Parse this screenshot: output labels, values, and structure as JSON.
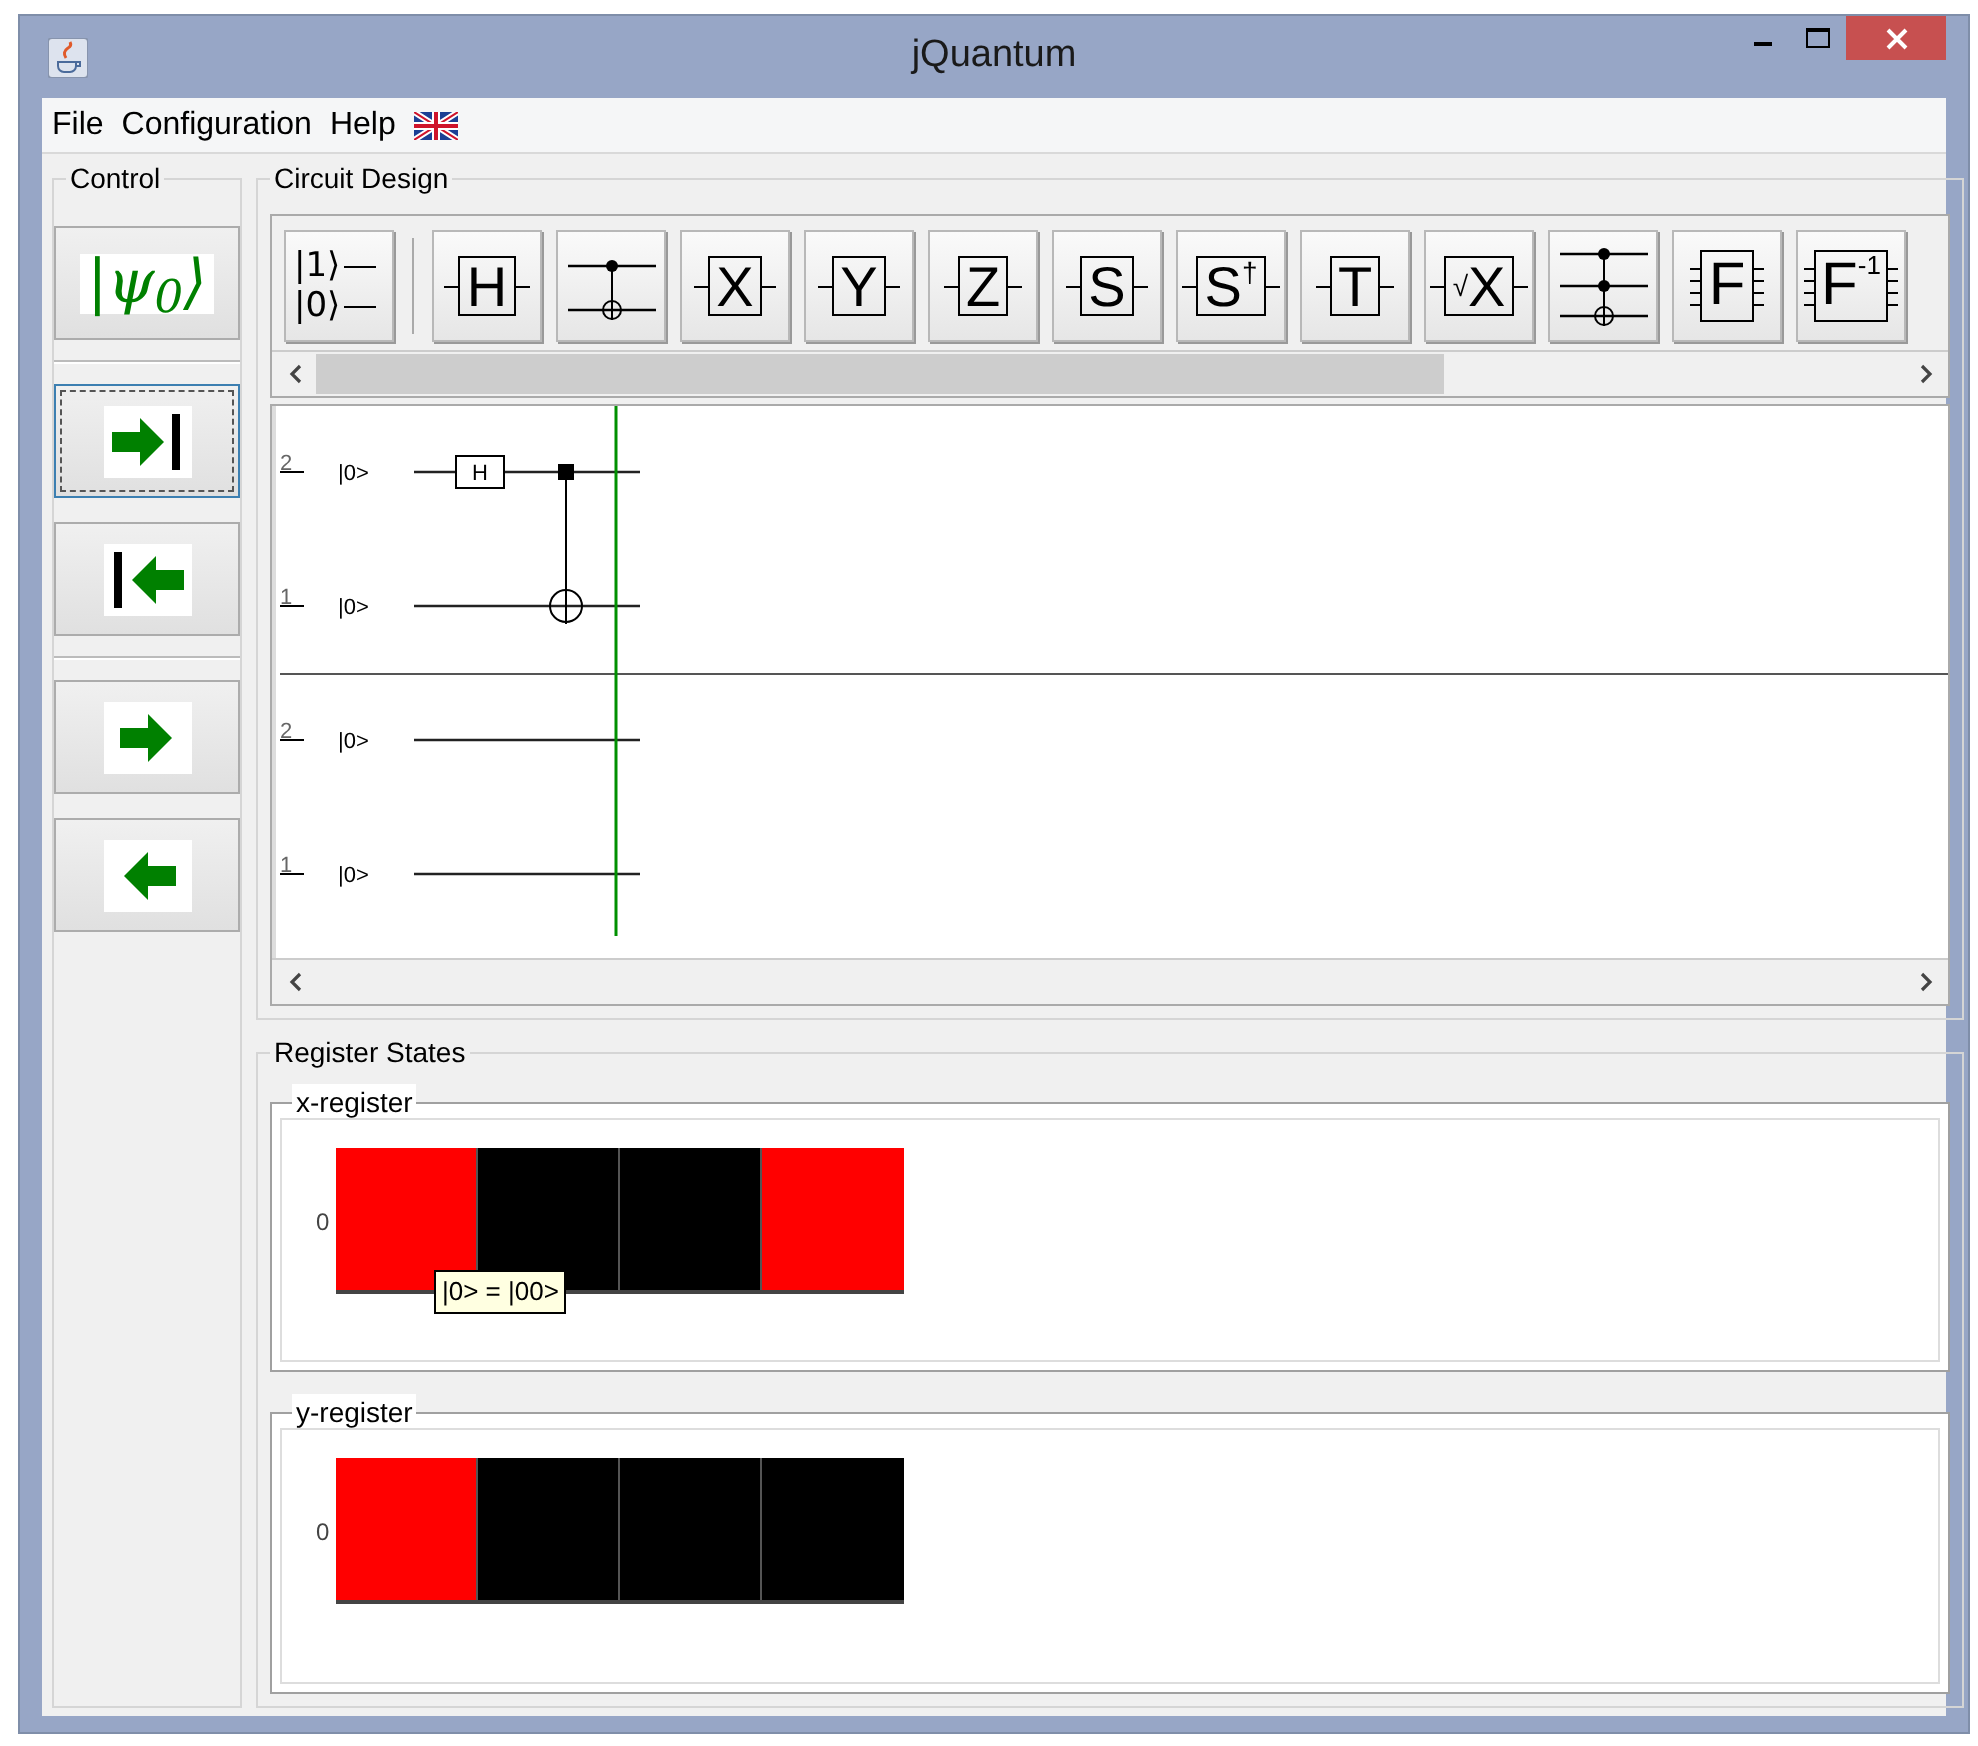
{
  "window": {
    "title": "jQuantum"
  },
  "menu": [
    "File",
    "Configuration",
    "Help"
  ],
  "control": {
    "title": "Control",
    "buttons": [
      {
        "kind": "init",
        "label": "|ψ$_{0}$⟩",
        "focused": false
      },
      {
        "kind": "step-forward",
        "focused": true
      },
      {
        "kind": "step-back",
        "focused": false
      },
      {
        "kind": "run-forward",
        "focused": false
      },
      {
        "kind": "run-back",
        "focused": false
      }
    ]
  },
  "circuit_design": {
    "title": "Circuit Design",
    "toolbar": [
      {
        "kind": "init",
        "label": "|1⟩",
        "label2": "|0⟩"
      },
      {
        "kind": "gate",
        "label": "H"
      },
      {
        "kind": "cnot"
      },
      {
        "kind": "gate",
        "label": "X"
      },
      {
        "kind": "gate",
        "label": "Y"
      },
      {
        "kind": "gate",
        "label": "Z"
      },
      {
        "kind": "gate",
        "label": "S"
      },
      {
        "kind": "gate",
        "label": "S",
        "sup": "†"
      },
      {
        "kind": "gate",
        "label": "T"
      },
      {
        "kind": "gate",
        "label": "X",
        "prefix": "√"
      },
      {
        "kind": "toffoli"
      },
      {
        "kind": "multi",
        "label": "F"
      },
      {
        "kind": "multi",
        "label": "F",
        "sup": "-1"
      }
    ],
    "registers": [
      {
        "qubits": [
          {
            "index": "2",
            "state": "|0>"
          },
          {
            "index": "1",
            "state": "|0>"
          }
        ],
        "gates": [
          {
            "kind": "single",
            "label": "H"
          },
          {
            "kind": "cnot"
          }
        ]
      },
      {
        "qubits": [
          {
            "index": "2",
            "state": "|0>"
          },
          {
            "index": "1",
            "state": "|0>"
          }
        ]
      }
    ]
  },
  "register_states": {
    "title": "Register States",
    "registers": [
      {
        "title": "x-register",
        "row_label": "0",
        "cells": [
          {
            "color": "#ff0000"
          },
          {
            "color": "#000000"
          },
          {
            "color": "#000000"
          },
          {
            "color": "#ff0000"
          }
        ],
        "tooltip": "|0> = |00>"
      },
      {
        "title": "y-register",
        "row_label": "0",
        "cells": [
          {
            "color": "#ff0000"
          },
          {
            "color": "#000000"
          },
          {
            "color": "#000000"
          },
          {
            "color": "#000000"
          }
        ]
      }
    ]
  }
}
